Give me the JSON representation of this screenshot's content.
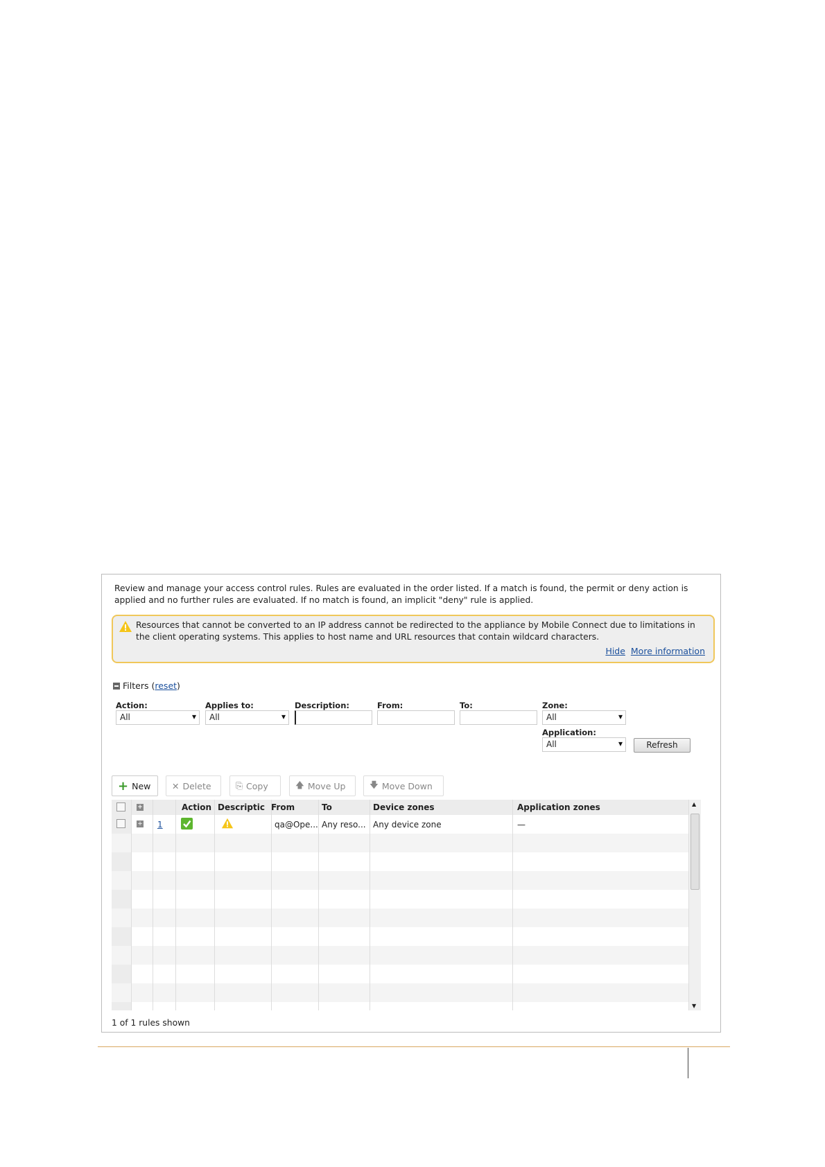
{
  "intro": "Review and manage your access control rules. Rules are evaluated in the order listed. If a match is found, the permit or deny action is applied and no further rules are evaluated. If no match is found, an implicit \"deny\" rule is applied.",
  "warning": {
    "text": "Resources that cannot be converted to an IP address cannot be redirected to the appliance by Mobile Connect due to limitations in the client operating systems. This applies to host name and URL resources that contain wildcard characters.",
    "hide": "Hide",
    "more": "More information",
    "color": "#f0c75a"
  },
  "filters": {
    "title": "Filters",
    "open_paren": "(",
    "reset": "reset",
    "close_paren": ")",
    "action_label": "Action:",
    "action_value": "All",
    "applies_label": "Applies to:",
    "applies_value": "All",
    "description_label": "Description:",
    "description_value": "",
    "from_label": "From:",
    "from_value": "",
    "to_label": "To:",
    "to_value": "",
    "zone_label": "Zone:",
    "zone_value": "All",
    "application_label": "Application:",
    "application_value": "All",
    "refresh": "Refresh"
  },
  "toolbar": {
    "new": "New",
    "delete": "Delete",
    "copy": "Copy",
    "move_up": "Move Up",
    "move_down": "Move Down"
  },
  "table": {
    "columns": [
      "Action",
      "Descriptic",
      "From",
      "To",
      "Device zones",
      "Application zones"
    ],
    "rows": [
      {
        "num": "1",
        "from": "qa@Ope...",
        "to": "Any reso...",
        "device_zones": "Any device zone",
        "application_zones": "—"
      }
    ]
  },
  "footer": "1 of 1 rules shown"
}
